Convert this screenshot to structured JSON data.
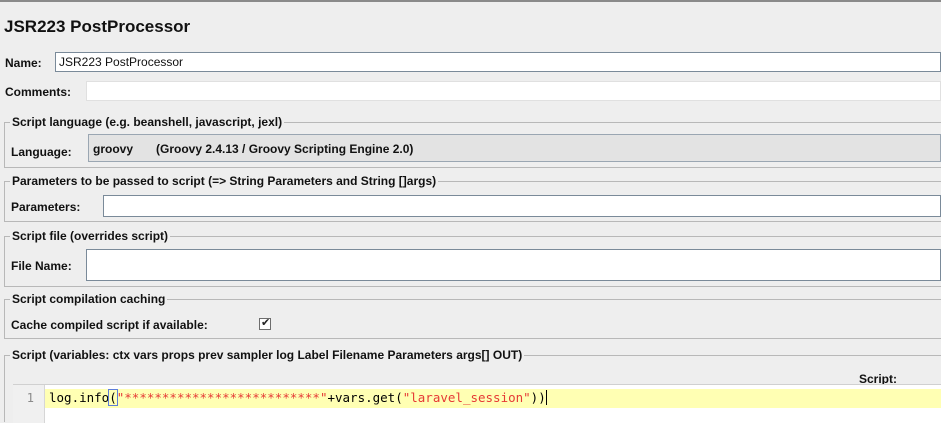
{
  "title": "JSR223 PostProcessor",
  "name": {
    "label": "Name:",
    "value": "JSR223 PostProcessor"
  },
  "comments": {
    "label": "Comments:",
    "value": ""
  },
  "script_language": {
    "legend": "Script language (e.g. beanshell, javascript, jexl)",
    "label": "Language:",
    "value": "groovy",
    "engine": "(Groovy 2.4.13 / Groovy Scripting Engine 2.0)"
  },
  "parameters": {
    "legend": "Parameters to be passed to script (=> String Parameters and String []args)",
    "label": "Parameters:",
    "value": ""
  },
  "script_file": {
    "legend": "Script file (overrides script)",
    "label": "File Name:",
    "value": ""
  },
  "caching": {
    "legend": "Script compilation caching",
    "label": "Cache compiled script if available:",
    "checked": true
  },
  "script": {
    "legend": "Script (variables: ctx vars props prev sampler log Label Filename Parameters args[] OUT)",
    "header": "Script:",
    "line_number": "1",
    "code_prefix": "log.info",
    "code_open_paren": "(",
    "code_string": "\"**************************\"",
    "code_suffix": "+vars.get(",
    "code_arg": "\"laravel_session\"",
    "code_close": "))"
  },
  "colors": {
    "background": "#eeeeee",
    "current_line": "#ffffb3",
    "string": "#e53935"
  }
}
